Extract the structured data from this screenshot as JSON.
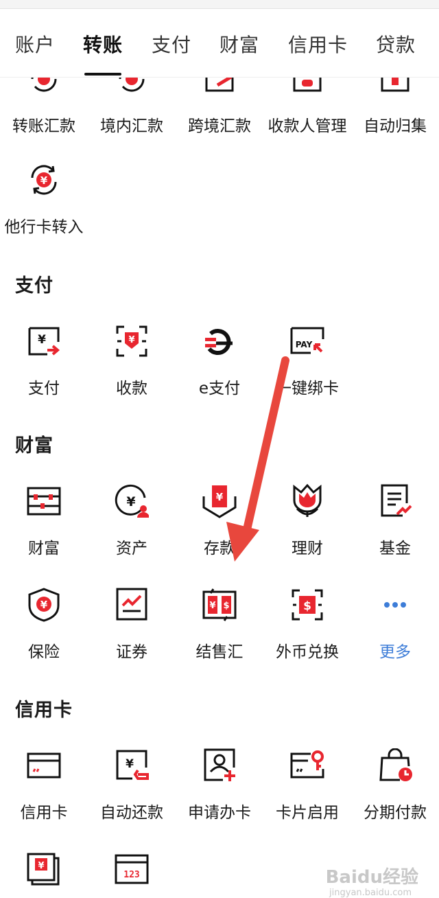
{
  "tabs": [
    "账户",
    "转账",
    "支付",
    "财富",
    "信用卡",
    "贷款"
  ],
  "transfer_items": [
    "转账汇款",
    "境内汇款",
    "跨境汇款",
    "收款人管理",
    "自动归集",
    "他行卡转入"
  ],
  "sections": {
    "payment": {
      "title": "支付",
      "items": [
        "支付",
        "收款",
        "e支付",
        "一键绑卡"
      ]
    },
    "wealth": {
      "title": "财富",
      "items": [
        "财富",
        "资产",
        "存款",
        "理财",
        "基金",
        "保险",
        "证券",
        "结售汇",
        "外币兑换",
        "更多"
      ]
    },
    "credit": {
      "title": "信用卡",
      "items": [
        "信用卡",
        "自动还款",
        "申请办卡",
        "卡片启用",
        "分期付款"
      ]
    }
  },
  "icon_texts": {
    "pay_card": "PAY",
    "card_number": "123"
  },
  "watermark": {
    "brand": "Baidu经验",
    "url": "jingyan.baidu.com"
  },
  "colors": {
    "accent_red": "#e8262f",
    "link_blue": "#3d7dd8",
    "arrow_red": "#e8473d"
  }
}
